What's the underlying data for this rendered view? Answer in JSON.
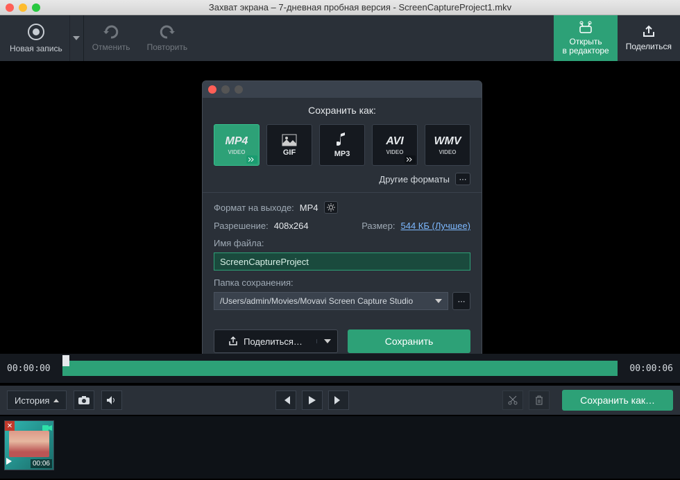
{
  "window": {
    "title": "Захват экрана – 7-дневная пробная версия - ScreenCaptureProject1.mkv"
  },
  "toolbar": {
    "new_record": "Новая запись",
    "undo": "Отменить",
    "redo": "Повторить",
    "open_editor_l1": "Открыть",
    "open_editor_l2": "в редакторе",
    "share": "Поделиться"
  },
  "dialog": {
    "title": "Сохранить как:",
    "formats": [
      {
        "label": "MP4",
        "sub": "VIDEO",
        "selected": true,
        "has_more": true,
        "icon": "mp4"
      },
      {
        "label": "GIF",
        "sub": "",
        "selected": false,
        "has_more": false,
        "icon": "gif"
      },
      {
        "label": "MP3",
        "sub": "",
        "selected": false,
        "has_more": false,
        "icon": "mp3"
      },
      {
        "label": "AVI",
        "sub": "VIDEO",
        "selected": false,
        "has_more": true,
        "icon": "avi"
      },
      {
        "label": "WMV",
        "sub": "VIDEO",
        "selected": false,
        "has_more": false,
        "icon": "wmv"
      }
    ],
    "other_formats": "Другие форматы",
    "output_format_label": "Формат на выходе:",
    "output_format_value": "MP4",
    "resolution_label": "Разрешение:",
    "resolution_value": "408x264",
    "size_label": "Размер:",
    "size_value": "544 КБ (Лучшее)",
    "filename_label": "Имя файла:",
    "filename_value": "ScreenCaptureProject",
    "folder_label": "Папка сохранения:",
    "folder_value": "/Users/admin/Movies/Movavi Screen Capture Studio",
    "share": "Поделиться…",
    "save": "Сохранить"
  },
  "timeline": {
    "start": "00:00:00",
    "end": "00:00:06"
  },
  "controls": {
    "history": "История",
    "save_as": "Сохранить как…"
  },
  "clip": {
    "duration": "00:06"
  }
}
